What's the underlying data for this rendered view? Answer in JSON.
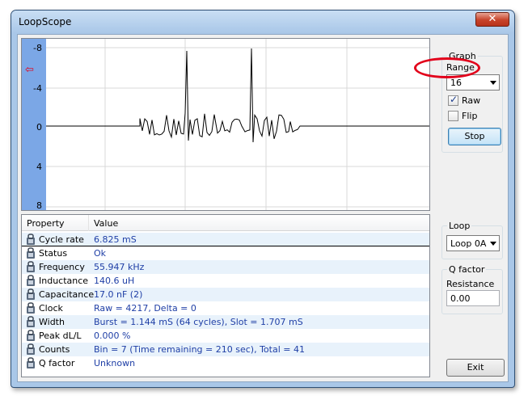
{
  "window": {
    "title": "LoopScope",
    "close_glyph": "✕"
  },
  "scope": {
    "y_ticks": [
      "-8",
      "-4",
      "0",
      "4",
      "8"
    ],
    "marker_glyph": "⇦"
  },
  "property_list": {
    "headers": {
      "property": "Property",
      "value": "Value"
    },
    "rows": [
      {
        "name": "Cycle rate",
        "value": "6.825 mS"
      },
      {
        "name": "Status",
        "value": "Ok"
      },
      {
        "name": "Frequency",
        "value": "55.947 kHz"
      },
      {
        "name": "Inductance",
        "value": "140.6 uH"
      },
      {
        "name": "Capacitance",
        "value": "17.0 nF (2)"
      },
      {
        "name": "Clock",
        "value": "Raw = 4217, Delta = 0"
      },
      {
        "name": "Width",
        "value": "Burst = 1.144 mS (64 cycles), Slot = 1.707 mS"
      },
      {
        "name": "Peak dL/L",
        "value": "0.000 %"
      },
      {
        "name": "Counts",
        "value": "Bin = 7 (Time remaining = 210 sec), Total = 41"
      },
      {
        "name": "Q factor",
        "value": "Unknown"
      }
    ]
  },
  "graph": {
    "group_label": "Graph",
    "range_label": "Range",
    "range_value": "16",
    "raw_label": "Raw",
    "raw_checked": true,
    "flip_label": "Flip",
    "flip_checked": false,
    "stop_label": "Stop"
  },
  "loop": {
    "group_label": "Loop",
    "value": "Loop 0A"
  },
  "qfactor": {
    "group_label": "Q factor",
    "resistance_label": "Resistance",
    "resistance_value": "0.00"
  },
  "exit_label": "Exit",
  "colors": {
    "accent_ring": "#e2001a",
    "value_text": "#1f3fa6",
    "scope_axis": "#7ba7e6"
  }
}
